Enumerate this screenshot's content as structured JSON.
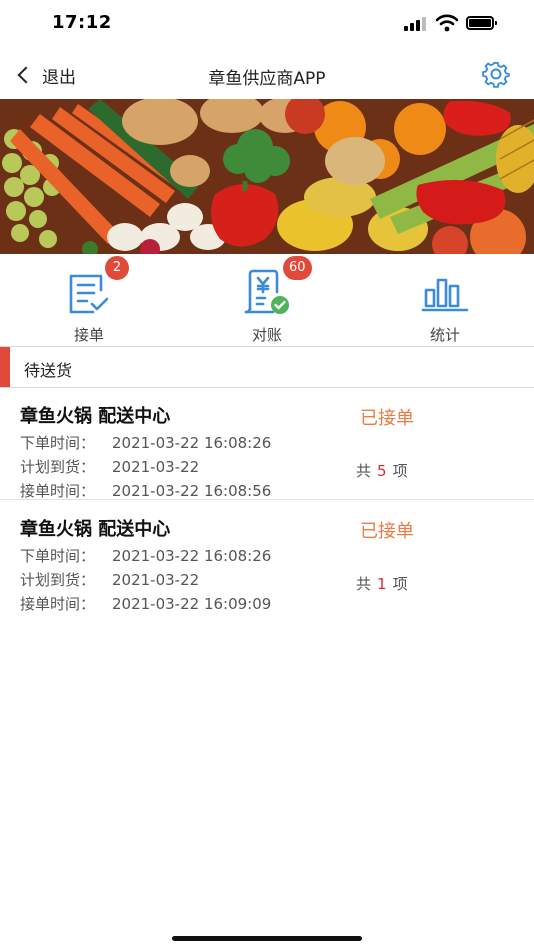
{
  "status_bar": {
    "time": "17:12"
  },
  "nav": {
    "back_label": "退出",
    "title": "章鱼供应商APP"
  },
  "menu": [
    {
      "label": "接单",
      "badge": "2",
      "icon": "receive-order-icon"
    },
    {
      "label": "对账",
      "badge": "60",
      "icon": "reconcile-icon"
    },
    {
      "label": "统计",
      "badge": "",
      "icon": "statistics-icon"
    }
  ],
  "section": {
    "title": "待送货"
  },
  "orders": [
    {
      "title": "章鱼火锅 配送中心",
      "status": "已接单",
      "order_time_label": "下单时间：",
      "order_time": "2021-03-22 16:08:26",
      "planned_label": "计划到货：",
      "planned": "2021-03-22",
      "accept_time_label": "接单时间：",
      "accept_time": "2021-03-22 16:08:56",
      "count_prefix": "共",
      "count": "5",
      "count_suffix": "项"
    },
    {
      "title": "章鱼火锅 配送中心",
      "status": "已接单",
      "order_time_label": "下单时间：",
      "order_time": "2021-03-22 16:08:26",
      "planned_label": "计划到货：",
      "planned": "2021-03-22",
      "accept_time_label": "接单时间：",
      "accept_time": "2021-03-22 16:09:09",
      "count_prefix": "共",
      "count": "1",
      "count_suffix": "项"
    }
  ],
  "colors": {
    "accent_red": "#e04a3a",
    "status_orange": "#ee7a42",
    "icon_blue": "#3a8bd8"
  }
}
